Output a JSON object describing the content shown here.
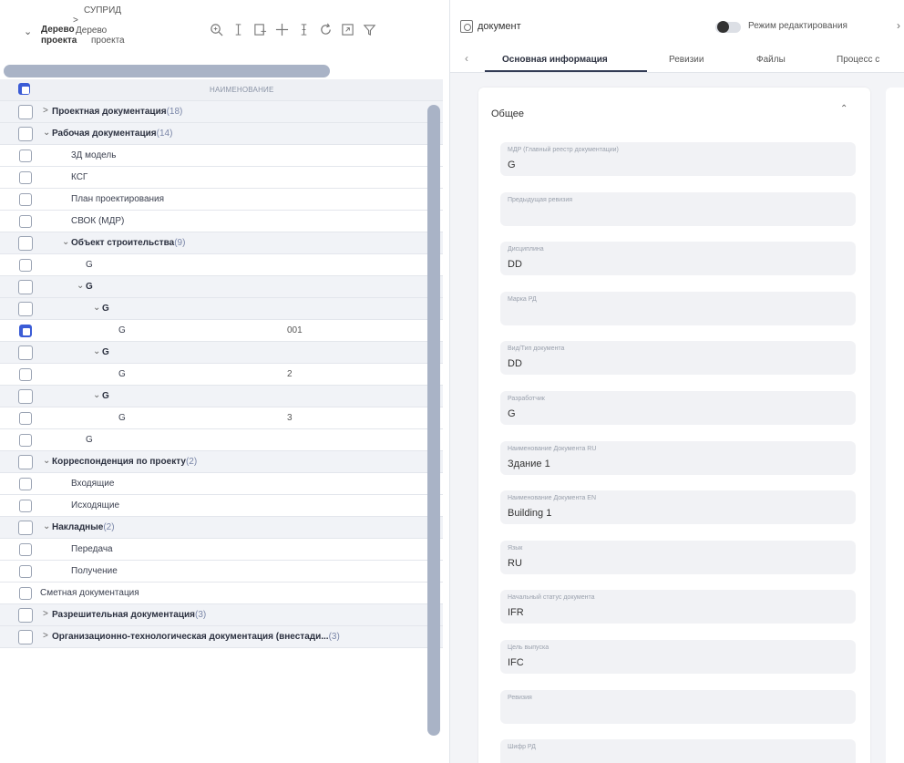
{
  "left": {
    "breadcrumb_title_1": "Дерево",
    "breadcrumb_title_2": "проекта",
    "breadcrumb_path": [
      "СУПРИД",
      ">",
      "Дерево",
      "проекта"
    ],
    "column_header": "НАИМЕНОВАНИЕ",
    "rows": [
      {
        "label": "Проектная документация",
        "count": "(18)",
        "bold": true,
        "group": true,
        "caret": ">",
        "indent": 0
      },
      {
        "label": "Рабочая документация",
        "count": "(14)",
        "bold": true,
        "group": true,
        "caret": "⌄",
        "indent": 0
      },
      {
        "label": "3Д модель",
        "count": "",
        "bold": false,
        "group": false,
        "caret": "",
        "indent": 1
      },
      {
        "label": "КСГ",
        "count": "",
        "bold": false,
        "group": false,
        "caret": "",
        "indent": 1
      },
      {
        "label": "План проектирования",
        "count": "",
        "bold": false,
        "group": false,
        "caret": "",
        "indent": 1
      },
      {
        "label": "СВОК (МДР)",
        "count": "",
        "bold": false,
        "group": false,
        "caret": "",
        "indent": 1
      },
      {
        "label": "Объект строительства",
        "count": "(9)",
        "bold": true,
        "group": true,
        "caret": "⌄",
        "indent": 1
      },
      {
        "label": "G",
        "count": "",
        "bold": false,
        "group": false,
        "caret": "",
        "indent": 2
      },
      {
        "label": "G",
        "count": "",
        "bold": true,
        "group": true,
        "caret": "⌄",
        "indent": 2
      },
      {
        "label": "G",
        "count": "",
        "bold": true,
        "group": true,
        "caret": "⌄",
        "indent": 3
      },
      {
        "label": "G",
        "count": "",
        "bold": false,
        "group": false,
        "caret": "",
        "indent": 4,
        "col2": "001",
        "checked": true
      },
      {
        "label": "G",
        "count": "",
        "bold": true,
        "group": true,
        "caret": "⌄",
        "indent": 3
      },
      {
        "label": "G",
        "count": "",
        "bold": false,
        "group": false,
        "caret": "",
        "indent": 4,
        "col2": "2"
      },
      {
        "label": "G",
        "count": "",
        "bold": true,
        "group": true,
        "caret": "⌄",
        "indent": 3
      },
      {
        "label": "G",
        "count": "",
        "bold": false,
        "group": false,
        "caret": "",
        "indent": 4,
        "col2": "3"
      },
      {
        "label": "G",
        "count": "",
        "bold": false,
        "group": false,
        "caret": "",
        "indent": 2
      },
      {
        "label": "Корреспонденция по проекту",
        "count": "(2)",
        "bold": true,
        "group": true,
        "caret": "⌄",
        "indent": 0
      },
      {
        "label": "Входящие",
        "count": "",
        "bold": false,
        "group": false,
        "caret": "",
        "indent": 1
      },
      {
        "label": "Исходящие",
        "count": "",
        "bold": false,
        "group": false,
        "caret": "",
        "indent": 1
      },
      {
        "label": "Накладные",
        "count": "(2)",
        "bold": true,
        "group": true,
        "caret": "⌄",
        "indent": 0
      },
      {
        "label": "Передача",
        "count": "",
        "bold": false,
        "group": false,
        "caret": "",
        "indent": 1
      },
      {
        "label": "Получение",
        "count": "",
        "bold": false,
        "group": false,
        "caret": "",
        "indent": 1
      },
      {
        "label": "Сметная документация",
        "count": "",
        "bold": false,
        "group": false,
        "caret": "",
        "indent": 0
      },
      {
        "label": "Разрешительная документация",
        "count": "(3)",
        "bold": true,
        "group": true,
        "caret": ">",
        "indent": 0
      },
      {
        "label": "Организационно-технологическая документация (внестади...",
        "count": "(3)",
        "bold": true,
        "group": true,
        "caret": ">",
        "indent": 0
      }
    ]
  },
  "right": {
    "doc_title": "документ",
    "edit_mode_label": "Режим редактирования",
    "tabs": [
      {
        "label": "Основная информация",
        "active": true
      },
      {
        "label": "Ревизии",
        "active": false
      },
      {
        "label": "Файлы",
        "active": false
      },
      {
        "label": "Процесс с",
        "active": false
      }
    ],
    "section_title": "Общее",
    "fields": [
      {
        "label": "МДР (Главный реестр документации)",
        "value": "G"
      },
      {
        "label": "Предыдущая ревизия",
        "value": ""
      },
      {
        "label": "Дисциплина",
        "value": "DD"
      },
      {
        "label": "Марка РД",
        "value": ""
      },
      {
        "label": "Вид/Тип документа",
        "value": "DD"
      },
      {
        "label": "Разработчик",
        "value": "G"
      },
      {
        "label": "Наименование Документа RU",
        "value": "Здание 1"
      },
      {
        "label": "Наименование Документа EN",
        "value": "Building 1"
      },
      {
        "label": "Язык",
        "value": "RU"
      },
      {
        "label": "Начальный статус документа",
        "value": "IFR"
      },
      {
        "label": "Цель выпуска",
        "value": "IFC"
      },
      {
        "label": "Ревизия",
        "value": ""
      },
      {
        "label": "Шифр РД",
        "value": ""
      }
    ]
  }
}
